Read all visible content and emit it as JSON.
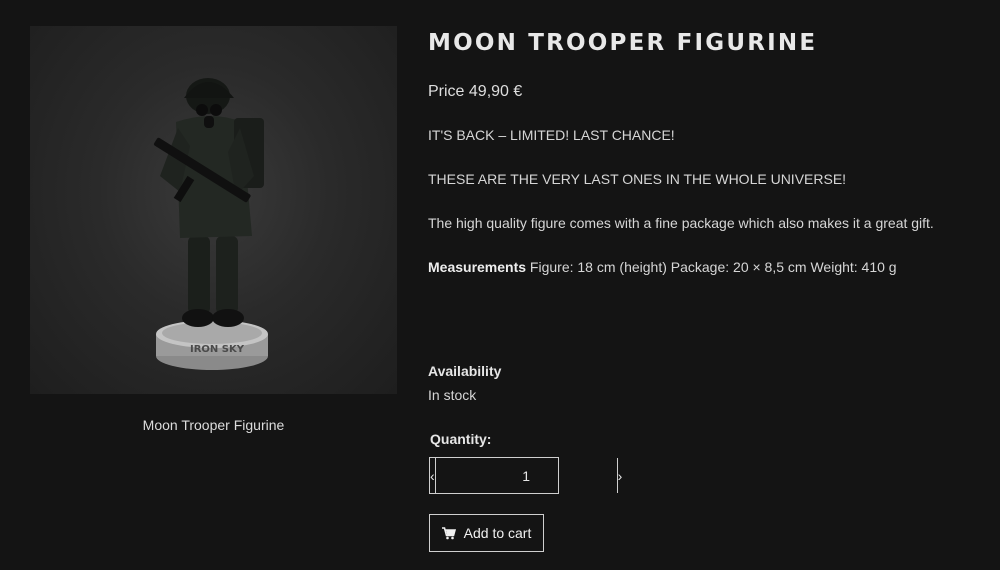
{
  "product": {
    "title": "MOON TROOPER FIGURINE",
    "price": "Price 49,90 €",
    "image_caption": "Moon Trooper Figurine",
    "base_text": "IRON SKY"
  },
  "description": {
    "line1": "IT'S BACK – LIMITED! LAST CHANCE!",
    "line2": "THESE ARE THE VERY LAST ONES IN THE WHOLE UNIVERSE!",
    "line3": "The high quality figure comes with a fine package which also makes it a great gift.",
    "measurements_label": "Measurements",
    "measurements_value": " Figure: 18 cm (height) Package: 20 × 8,5 cm Weight: 410 g"
  },
  "availability": {
    "label": "Availability",
    "value": "In stock"
  },
  "quantity": {
    "label": "Quantity:",
    "value": "1",
    "decrement": "‹",
    "increment": "›"
  },
  "cart": {
    "label": "Add to cart",
    "icon": "shopping-cart-icon"
  },
  "colors": {
    "background": "#141414",
    "text": "#e6e6e6",
    "border": "#cfcfcf"
  }
}
